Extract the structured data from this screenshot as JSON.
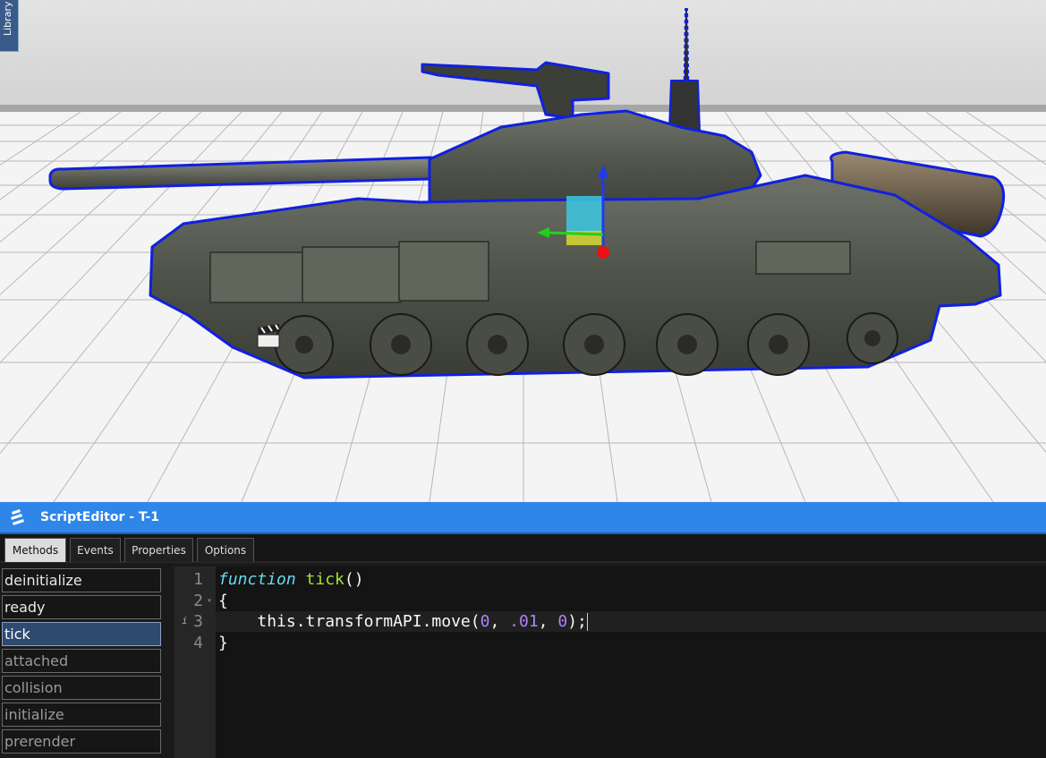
{
  "viewport": {
    "library_tab_label": "Library",
    "selection_color": "#1020e0"
  },
  "editor": {
    "title": "ScriptEditor - T-1",
    "accent_color": "#2e86e8",
    "tabs": [
      {
        "label": "Methods",
        "active": true
      },
      {
        "label": "Events",
        "active": false
      },
      {
        "label": "Properties",
        "active": false
      },
      {
        "label": "Options",
        "active": false
      }
    ],
    "methods": [
      {
        "label": "deinitialize",
        "state": "normal"
      },
      {
        "label": "ready",
        "state": "normal"
      },
      {
        "label": "tick",
        "state": "selected"
      },
      {
        "label": "attached",
        "state": "dim"
      },
      {
        "label": "collision",
        "state": "dim"
      },
      {
        "label": "initialize",
        "state": "dim"
      },
      {
        "label": "prerender",
        "state": "dim"
      }
    ],
    "code": {
      "line_numbers": [
        "1",
        "2",
        "3",
        "4"
      ],
      "info_marker": "i",
      "fold_marker": "▾",
      "line1": {
        "keyword": "function",
        "name": "tick",
        "rest": "()"
      },
      "line2": "{",
      "line3": {
        "indent": "    ",
        "prefix": "this.transformAPI.move(",
        "a": "0",
        "sep1": ", ",
        "b": ".01",
        "sep2": ", ",
        "c": "0",
        "suffix": ");"
      },
      "line4": "}"
    }
  }
}
